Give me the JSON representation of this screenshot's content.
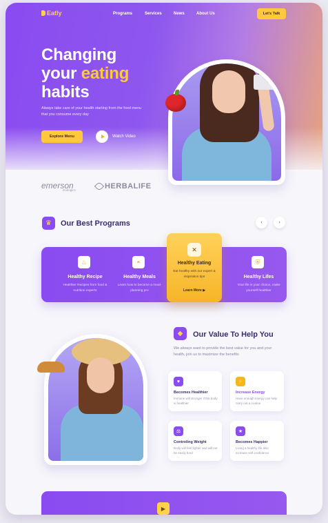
{
  "brand": {
    "name": "Eatly",
    "accent": "#ffc83d",
    "primary": "#8a4bf0"
  },
  "nav": {
    "links": [
      "Programs",
      "Services",
      "News",
      "About Us"
    ],
    "cta": "Let's Talk"
  },
  "hero": {
    "line1": "Changing",
    "line2_prefix": "your ",
    "line2_accent": "eating",
    "line3": "habits",
    "description": "Always take care of your health starting from the food menu that you consume every day",
    "primary_button": "Explore Menu",
    "secondary_button": "Watch Video"
  },
  "partners": {
    "first": "emerson",
    "first_sub": "ecologics",
    "second": "HERBALIFE"
  },
  "programs": {
    "title": "Our Best Programs",
    "items": [
      {
        "title": "Healthy Recipe",
        "desc": "Healthier Recipes from food & nutrition experts",
        "icon": "chef-hat-icon"
      },
      {
        "title": "Healthy Meals",
        "desc": "Learn how to become a meal-planning pro",
        "icon": "meal-cloche-icon"
      },
      {
        "title": "Healthy Eating",
        "desc": "Eat healthy with our expert & inspiration tips",
        "icon": "utensils-icon",
        "link": "Learn More",
        "featured": true
      },
      {
        "title": "Healthy Lifes",
        "desc": "Your life is your choice, make yourself healthier",
        "icon": "shield-icon"
      }
    ]
  },
  "value": {
    "title": "Our Value To Help You",
    "description": "We always want to provide the best value for you and your health, join us to maximize the benefits",
    "items": [
      {
        "title": "Becomes Healthier",
        "desc": "Immune will stronger if the body is healthier",
        "color": "#8a4bf0"
      },
      {
        "title": "Increase Energy",
        "desc": "Have enough energy can help carry out a routine",
        "color": "#f3b61f"
      },
      {
        "title": "Controling Weight",
        "desc": "Body will feel lighter and will not be easily tired",
        "color": "#8a4bf0"
      },
      {
        "title": "Becomes Happier",
        "desc": "Living a healthy life also increase self-confidence",
        "color": "#8a4bf0"
      }
    ]
  }
}
